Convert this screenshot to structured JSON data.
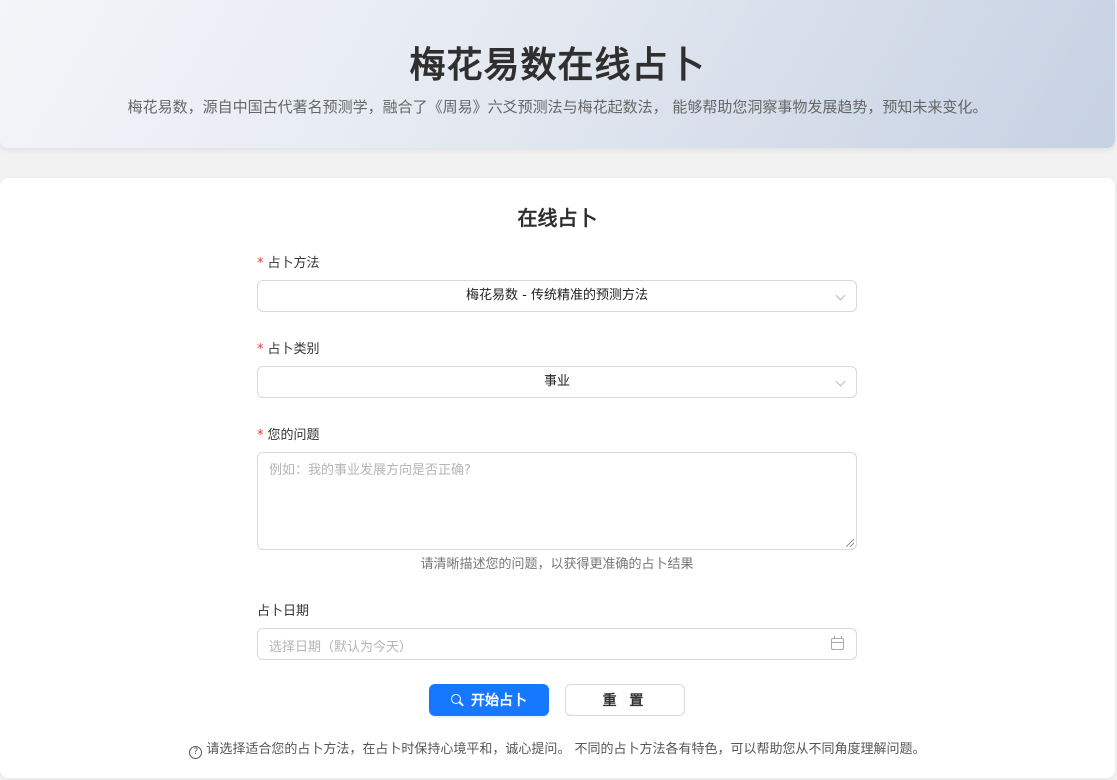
{
  "hero": {
    "title": "梅花易数在线占卜",
    "subtitle": "梅花易数，源自中国古代著名预测学，融合了《周易》六爻预测法与梅花起数法， 能够帮助您洞察事物发展趋势，预知未来变化。"
  },
  "form": {
    "title": "在线占卜",
    "required_mark": "*",
    "method": {
      "label": "占卜方法",
      "value": "梅花易数 - 传统精准的预测方法"
    },
    "category": {
      "label": "占卜类别",
      "value": "事业"
    },
    "question": {
      "label": "您的问题",
      "placeholder": "例如：我的事业发展方向是否正确?",
      "help": "请清晰描述您的问题，以获得更准确的占卜结果"
    },
    "date": {
      "label": "占卜日期",
      "placeholder": "选择日期（默认为今天）"
    },
    "submit_label": "开始占卜",
    "reset_label": "重 置",
    "note_icon": "?",
    "note": "请选择适合您的占卜方法，在占卜时保持心境平和，诚心提问。 不同的占卜方法各有特色，可以帮助您从不同角度理解问题。"
  }
}
